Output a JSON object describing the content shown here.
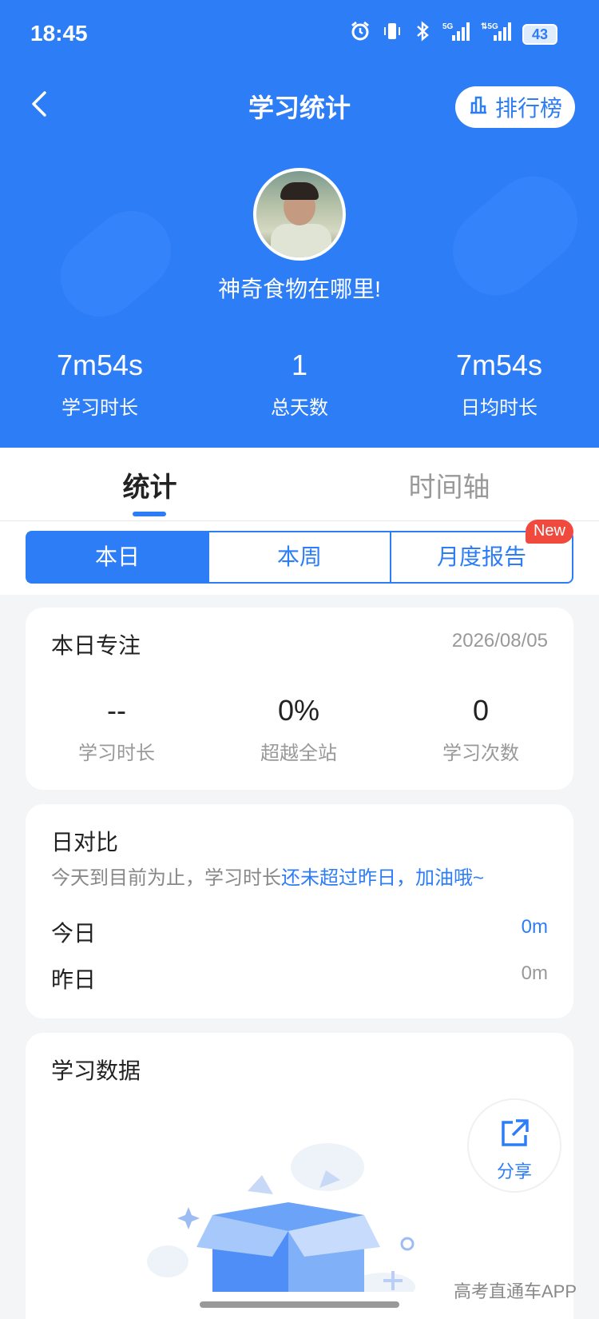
{
  "status_bar": {
    "time": "18:45",
    "battery": "43"
  },
  "nav": {
    "title": "学习统计",
    "rank_label": "排行榜"
  },
  "profile": {
    "username": "神奇食物在哪里!"
  },
  "summary": [
    {
      "value": "7m54s",
      "label": "学习时长"
    },
    {
      "value": "1",
      "label": "总天数"
    },
    {
      "value": "7m54s",
      "label": "日均时长"
    }
  ],
  "tabs": [
    {
      "label": "统计",
      "active": true
    },
    {
      "label": "时间轴",
      "active": false
    }
  ],
  "segments": [
    {
      "label": "本日",
      "active": true
    },
    {
      "label": "本周",
      "active": false
    },
    {
      "label": "月度报告",
      "active": false,
      "badge": "New"
    }
  ],
  "daily_focus": {
    "title": "本日专注",
    "date": "2026/08/05",
    "metrics": [
      {
        "value": "--",
        "label": "学习时长"
      },
      {
        "value": "0%",
        "label": "超越全站"
      },
      {
        "value": "0",
        "label": "学习次数"
      }
    ]
  },
  "comparison": {
    "title": "日对比",
    "subtitle_prefix": "今天到目前为止，学习时长",
    "subtitle_highlight": "还未超过昨日，加油哦~",
    "rows": [
      {
        "label": "今日",
        "value": "0m"
      },
      {
        "label": "昨日",
        "value": "0m"
      }
    ]
  },
  "study_data": {
    "title": "学习数据",
    "share_label": "分享"
  },
  "watermark": "高考直通车APP",
  "colors": {
    "primary": "#2d7df7",
    "badge": "#f04a3e"
  }
}
